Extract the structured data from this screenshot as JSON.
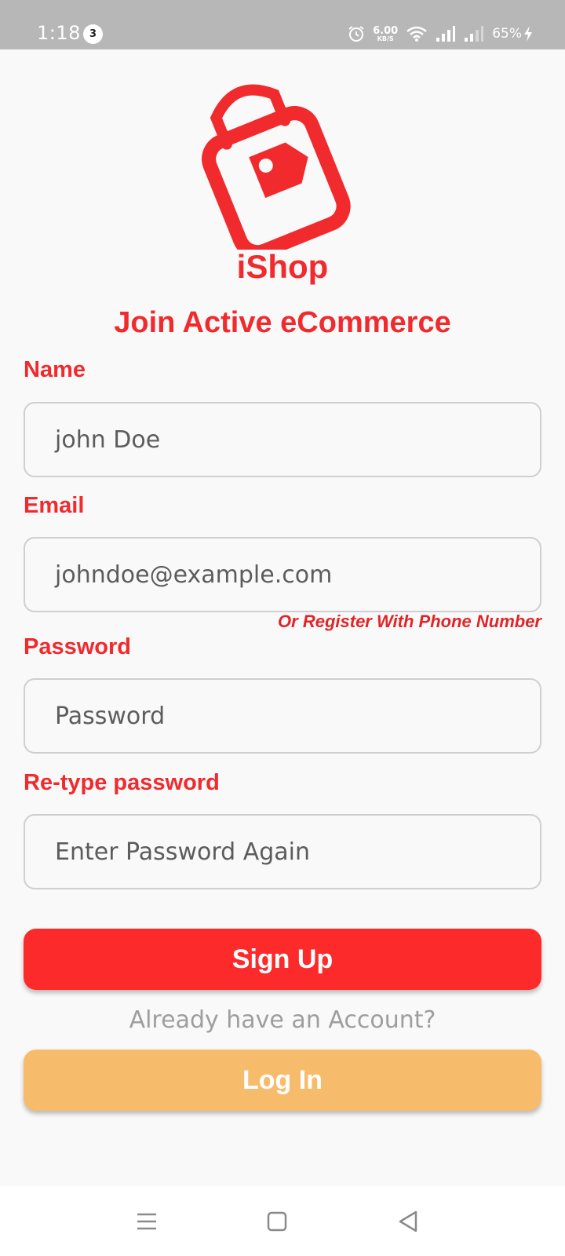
{
  "status_bar": {
    "time": "1:18",
    "notification_count": "3",
    "net_speed_value": "6.00",
    "net_speed_unit": "KB/S",
    "battery": "65%",
    "icons": [
      "alarm-icon",
      "wifi-icon",
      "signal-icon",
      "signal-weak-icon",
      "charging-icon"
    ]
  },
  "brand": {
    "name": "iShop",
    "color": "#f02a2d"
  },
  "headline": "Join Active eCommerce",
  "form": {
    "name": {
      "label": "Name",
      "value": "john Doe"
    },
    "email": {
      "label": "Email",
      "value": "johndoe@example.com"
    },
    "phone_link": "Or Register With Phone Number",
    "password": {
      "label": "Password",
      "placeholder": "Password"
    },
    "retype_password": {
      "label": "Re-type password",
      "placeholder": "Enter Password Again"
    },
    "signup_label": "Sign Up",
    "already_text": "Already have an Account?",
    "login_label": "Log In"
  },
  "colors": {
    "primary": "#fd2a2b",
    "secondary": "#f7bc6b",
    "status_bar": "#b7b7b7"
  },
  "nav_bar": {
    "icons": [
      "menu-icon",
      "home-square-icon",
      "back-triangle-icon"
    ]
  }
}
